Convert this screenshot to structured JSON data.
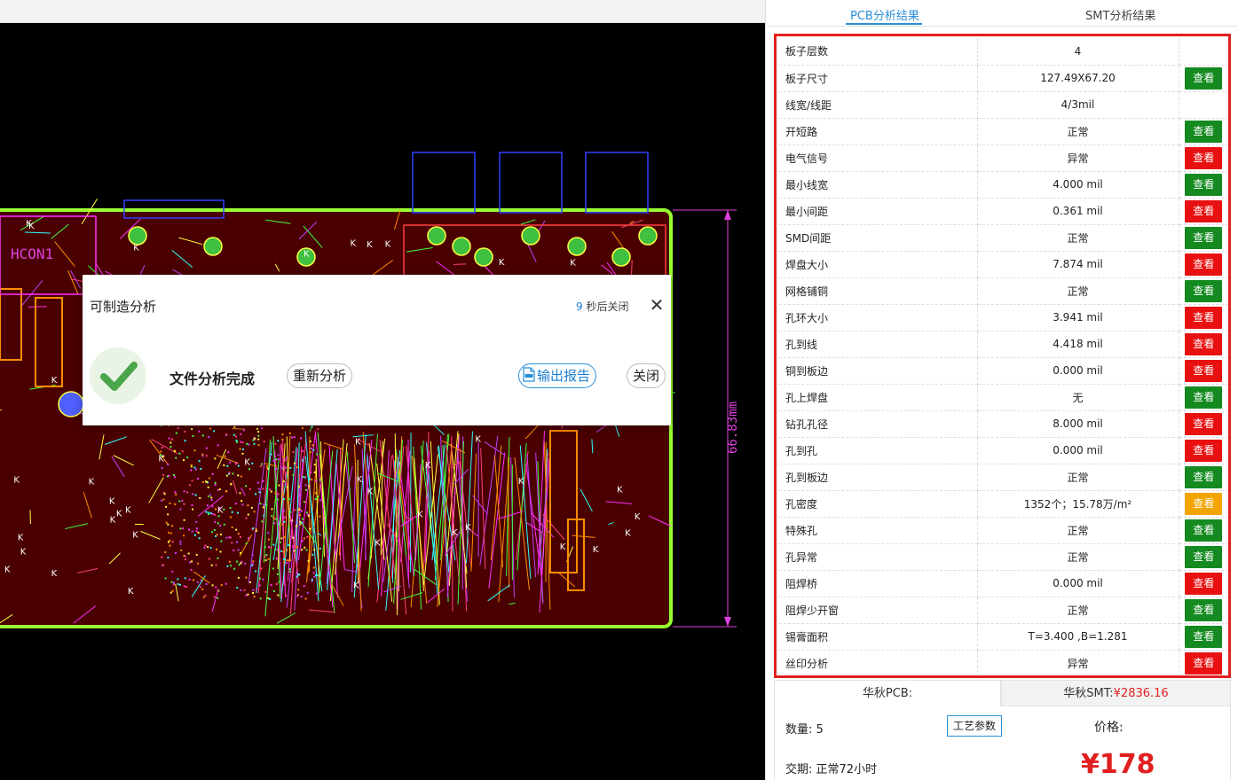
{
  "dialog": {
    "title": "可制造分析",
    "countdown_number": "9",
    "countdown_text": "秒后关闭",
    "close_x": "✕",
    "status": "文件分析完成",
    "reanalyze_label": "重新分析",
    "report_label": "输出报告",
    "close_label": "关闭"
  },
  "board": {
    "connector_label": "HCON1",
    "dimension_label": "66.83mm"
  },
  "tabs": {
    "pcb": "PCB分析结果",
    "smt": "SMT分析结果"
  },
  "results": [
    {
      "label": "板子层数",
      "value": "4",
      "status": "normal",
      "button": null
    },
    {
      "label": "板子尺寸",
      "value": "127.49X67.20",
      "status": "normal",
      "button": "查看"
    },
    {
      "label": "线宽/线距",
      "value": "4/3mil",
      "status": "normal",
      "button": null
    },
    {
      "label": "开短路",
      "value": "正常",
      "status": "normal",
      "button": "查看"
    },
    {
      "label": "电气信号",
      "value": "异常",
      "status": "error",
      "button": "查看"
    },
    {
      "label": "最小线宽",
      "value": "4.000 mil",
      "status": "normal",
      "button": "查看"
    },
    {
      "label": "最小间距",
      "value": "0.361 mil",
      "status": "error",
      "button": "查看"
    },
    {
      "label": "SMD间距",
      "value": "正常",
      "status": "normal",
      "button": "查看"
    },
    {
      "label": "焊盘大小",
      "value": "7.874 mil",
      "status": "error",
      "button": "查看"
    },
    {
      "label": "网格铺铜",
      "value": "正常",
      "status": "normal",
      "button": "查看"
    },
    {
      "label": "孔环大小",
      "value": "3.941 mil",
      "status": "error",
      "button": "查看"
    },
    {
      "label": "孔到线",
      "value": "4.418 mil",
      "status": "error",
      "button": "查看"
    },
    {
      "label": "铜到板边",
      "value": "0.000 mil",
      "status": "error",
      "button": "查看"
    },
    {
      "label": "孔上焊盘",
      "value": "无",
      "status": "normal",
      "button": "查看"
    },
    {
      "label": "钻孔孔径",
      "value": "8.000 mil",
      "status": "error",
      "button": "查看"
    },
    {
      "label": "孔到孔",
      "value": "0.000 mil",
      "status": "error",
      "button": "查看"
    },
    {
      "label": "孔到板边",
      "value": "正常",
      "status": "normal",
      "button": "查看"
    },
    {
      "label": "孔密度",
      "value": "1352个；15.78万/m²",
      "status": "warn",
      "button": "查看"
    },
    {
      "label": "特殊孔",
      "value": "正常",
      "status": "normal",
      "button": "查看"
    },
    {
      "label": "孔异常",
      "value": "正常",
      "status": "normal",
      "button": "查看"
    },
    {
      "label": "阻焊桥",
      "value": "0.000 mil",
      "status": "error",
      "button": "查看"
    },
    {
      "label": "阻焊少开窗",
      "value": "正常",
      "status": "normal",
      "button": "查看"
    },
    {
      "label": "锡膏面积",
      "value": "T=3.400 ,B=1.281",
      "status": "normal",
      "button": "查看"
    },
    {
      "label": "丝印分析",
      "value": "异常",
      "status": "error",
      "button": "查看"
    }
  ],
  "summary": {
    "pcb_tab": "华秋PCB:",
    "smt_tab": "华秋SMT:",
    "smt_price": "¥2836.16",
    "qty_label": "数量:",
    "qty_value": "5",
    "process_label": "工艺参数",
    "price_label": "价格:",
    "delivery_label": "交期:",
    "delivery_value": "正常72小时",
    "price_value": "¥178"
  },
  "colors": {
    "error": "#e02020",
    "warn": "#f0a500",
    "view_normal": "#148a20",
    "view_error": "#e81010",
    "view_warn": "#f2a500",
    "accent": "#2a8fd8"
  }
}
